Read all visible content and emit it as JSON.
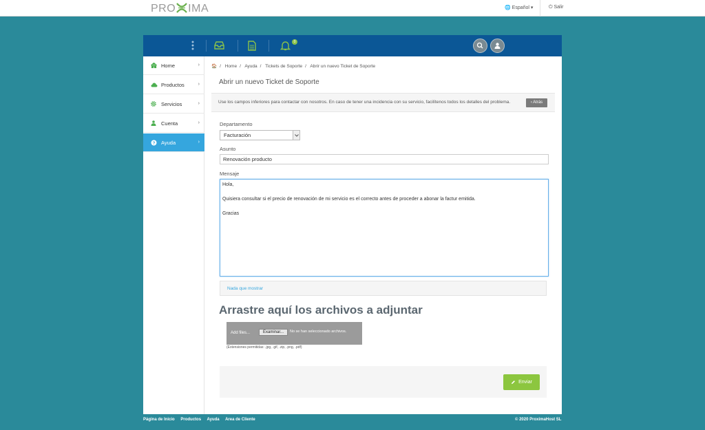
{
  "header": {
    "logo_text": "PROXIMA",
    "language_label": "Español",
    "logout_label": "Salir"
  },
  "navbar": {
    "notification_count": "0",
    "icons": [
      "more-vert-icon",
      "inbox-icon",
      "document-icon",
      "bell-icon",
      "search-icon",
      "user-icon"
    ]
  },
  "sidebar": {
    "items": [
      {
        "label": "Home",
        "icon": "home-icon"
      },
      {
        "label": "Productos",
        "icon": "cloud-icon"
      },
      {
        "label": "Servicios",
        "icon": "gear-icon"
      },
      {
        "label": "Cuenta",
        "icon": "user-icon"
      },
      {
        "label": "Ayuda",
        "icon": "help-icon",
        "active": true
      }
    ]
  },
  "breadcrumb": [
    "Home",
    "Ayuda",
    "Tickets de Soporte",
    "Abrir un nuevo Ticket de Soporte"
  ],
  "page_title": "Abrir un nuevo Ticket de Soporte",
  "info": {
    "text": "Use los campos inferiores para contactar con nosotros. En caso de tener una incidencia con su servicio, facilítenos todos los detalles del problema.",
    "back_label": "Atrás"
  },
  "form": {
    "department_label": "Departamento",
    "department_value": "Facturación",
    "subject_label": "Asunto",
    "subject_value": "Renovación producto",
    "message_label": "Mensaje",
    "message_value": "Hola,\n\nQuisiera consultar si el precio de renovación de mi servicio es el correcto antes de proceder a abonar la factur emitida.\n\nGracias",
    "empty_list_text": "Nada que mostrar",
    "drop_title": "Arrastre aquí los archivos a adjuntar",
    "add_files_label": "Add files...",
    "browse_label": "Examinar...",
    "no_file_label": "No se han seleccionado archivos.",
    "extensions_text": "(Extensiones permitidas: .jpg, .gif, .zip, .png, .pdf)",
    "send_label": "Enviar"
  },
  "footer": {
    "links": [
      "Página de Inicio",
      "Productos",
      "Ayuda",
      "Area de Cliente"
    ],
    "copyright": "© 2020 ProximaHost SL"
  },
  "colors": {
    "background": "#2a8a9a",
    "navbar": "#0b5796",
    "active": "#35a6de",
    "accent_green": "#8cc63f"
  }
}
